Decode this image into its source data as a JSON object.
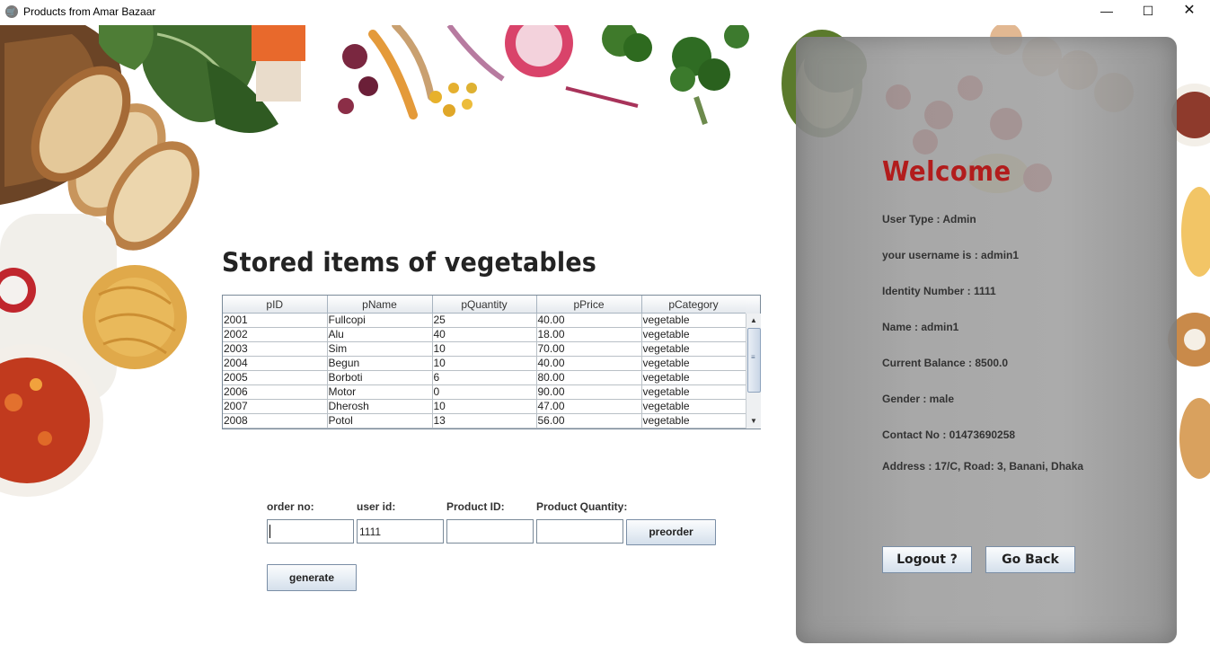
{
  "window": {
    "title": "Products from Amar Bazaar",
    "minimize_glyph": "—",
    "maximize_glyph": "☐",
    "close_glyph": "✕",
    "app_icon": "cart-icon"
  },
  "main": {
    "heading": "Stored items of vegetables",
    "table": {
      "columns": [
        "pID",
        "pName",
        "pQuantity",
        "pPrice",
        "pCategory"
      ],
      "rows": [
        [
          "2001",
          "Fullcopi",
          "25",
          "40.00",
          "vegetable"
        ],
        [
          "2002",
          "Alu",
          "40",
          "18.00",
          "vegetable"
        ],
        [
          "2003",
          "Sim",
          "10",
          "70.00",
          "vegetable"
        ],
        [
          "2004",
          "Begun",
          "10",
          "40.00",
          "vegetable"
        ],
        [
          "2005",
          "Borboti",
          "6",
          "80.00",
          "vegetable"
        ],
        [
          "2006",
          "Motor",
          "0",
          "90.00",
          "vegetable"
        ],
        [
          "2007",
          "Dherosh",
          "10",
          "47.00",
          "vegetable"
        ],
        [
          "2008",
          "Potol",
          "13",
          "56.00",
          "vegetable"
        ]
      ]
    }
  },
  "order_form": {
    "order_no_label": "order no:",
    "user_id_label": "user id:",
    "product_id_label": "Product ID:",
    "product_quantity_label": "Product Quantity:",
    "order_no_value": "",
    "user_id_value": "1111",
    "product_id_value": "",
    "product_quantity_value": "",
    "preorder_label": "preorder",
    "generate_label": "generate"
  },
  "panel": {
    "welcome": "Welcome",
    "user_type": "User Type : Admin",
    "username": "your username is : admin1",
    "identity": "Identity Number : 1111",
    "name": "Name : admin1",
    "balance": "Current Balance : 8500.0",
    "gender": "Gender : male",
    "contact": "Contact No : 01473690258",
    "address": "Address : 17/C, Road: 3, Banani, Dhaka",
    "logout_label": "Logout ?",
    "goback_label": "Go Back"
  },
  "colors": {
    "welcome": "#b21c1c",
    "heading": "#232323",
    "panel": "#9e9e9e"
  }
}
